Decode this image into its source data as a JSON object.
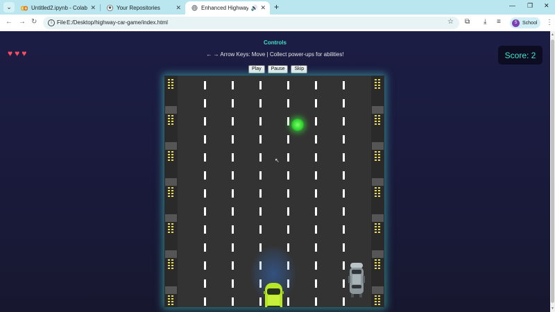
{
  "browser": {
    "tabs": [
      {
        "title": "Untitled2.ipynb - Colab",
        "active": false,
        "favicon": "colab-icon"
      },
      {
        "title": "Your Repositories",
        "active": false,
        "favicon": "github-icon"
      },
      {
        "title": "Enhanced Highway Car Gam",
        "active": true,
        "favicon": "globe-icon",
        "audio": true
      }
    ],
    "new_tab": "+",
    "address": {
      "chip": "File",
      "url": "E:/Desktop/highway-car-game/index.html"
    },
    "profile": {
      "initial": "S",
      "label": "School"
    }
  },
  "game": {
    "controls_title": "Controls",
    "instructions": "← → Arrow Keys: Move | Collect power-ups for abilities!",
    "buttons": {
      "play": "Play",
      "pause": "Pause",
      "skip": "Skip"
    },
    "score_label": "Score: 2",
    "lives": 3,
    "colors": {
      "accent": "#3fe0c5",
      "heart": "#ff4d5e",
      "player_car": "#b6e626",
      "powerup": "#3ee83e"
    }
  }
}
